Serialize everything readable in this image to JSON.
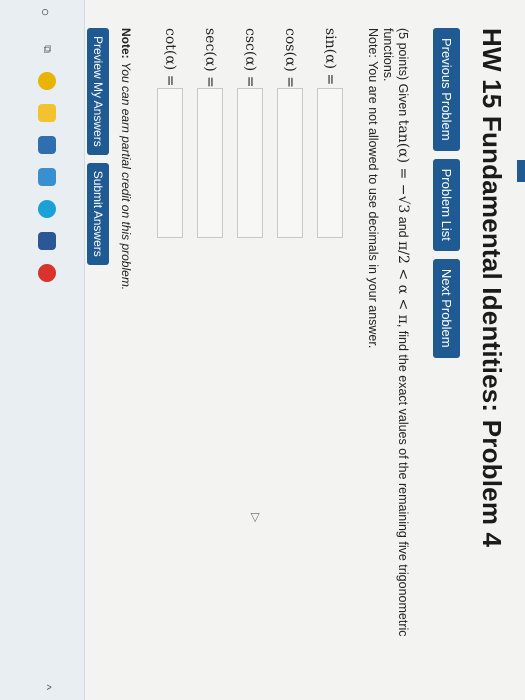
{
  "page": {
    "title": "HW 15 Fundamental Identities: Problem 4"
  },
  "nav": {
    "previous": "Previous Problem",
    "list": "Problem List",
    "next": "Next Problem"
  },
  "problem": {
    "points": "(5 points) Given",
    "given_tan": "tan(α) = −√3",
    "and_text": "and",
    "interval": "π/2 < α < π",
    "rest": ", find the exact values of the remaining five trigonometric functions.",
    "note": "Note: You are not allowed to use decimals in your answer."
  },
  "answers": [
    {
      "label": "sin(α) =",
      "value": ""
    },
    {
      "label": "cos(α) =",
      "value": ""
    },
    {
      "label": "csc(α) =",
      "value": ""
    },
    {
      "label": "sec(α) =",
      "value": ""
    },
    {
      "label": "cot(α) =",
      "value": ""
    }
  ],
  "footer": {
    "note_label": "Note:",
    "note_text": "You can earn partial credit on this problem.",
    "preview": "Preview My Answers",
    "submit": "Submit Answers"
  },
  "colors": {
    "button": "#1f5a93",
    "background": "#f3f3f1",
    "taskbar": "#e9eef3"
  },
  "taskbar": {
    "icons": [
      "search-icon",
      "task-view-icon",
      "chrome-icon",
      "file-explorer-icon",
      "store-icon",
      "photos-icon",
      "edge-icon",
      "word-icon",
      "chrome-icon-2"
    ]
  }
}
